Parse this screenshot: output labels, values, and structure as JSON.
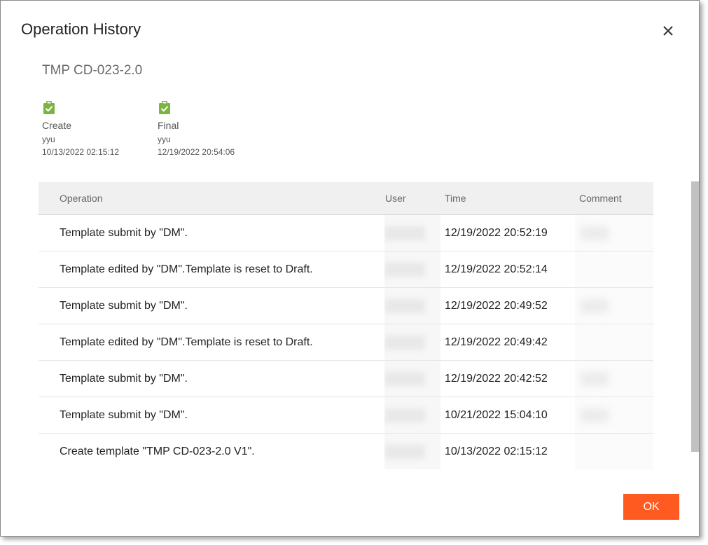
{
  "dialog": {
    "title": "Operation History",
    "ok_label": "OK"
  },
  "template": {
    "name": "TMP CD-023-2.0"
  },
  "steps": [
    {
      "label": "Create",
      "user": "yyu",
      "time": "10/13/2022 02:15:12",
      "icon": "clipboard-check-icon"
    },
    {
      "label": "Final",
      "user": "yyu",
      "time": "12/19/2022 20:54:06",
      "icon": "clipboard-check-icon"
    }
  ],
  "table": {
    "headers": {
      "operation": "Operation",
      "user": "User",
      "time": "Time",
      "comment": "Comment"
    },
    "rows": [
      {
        "operation": "Template submit by \"DM\".",
        "time": "12/19/2022 20:52:19"
      },
      {
        "operation": "Template edited by \"DM\".Template is reset to Draft.",
        "time": "12/19/2022 20:52:14"
      },
      {
        "operation": "Template submit by \"DM\".",
        "time": "12/19/2022 20:49:52"
      },
      {
        "operation": "Template edited by \"DM\".Template is reset to Draft.",
        "time": "12/19/2022 20:49:42"
      },
      {
        "operation": "Template submit by \"DM\".",
        "time": "12/19/2022 20:42:52"
      },
      {
        "operation": "Template submit by \"DM\".",
        "time": "10/21/2022 15:04:10"
      },
      {
        "operation": "Create template \"TMP CD-023-2.0 V1\".",
        "time": "10/13/2022 02:15:12"
      }
    ]
  },
  "colors": {
    "accent": "#ff5a1f",
    "step_icon": "#7cb342",
    "header_bg": "#f0f0f0"
  }
}
